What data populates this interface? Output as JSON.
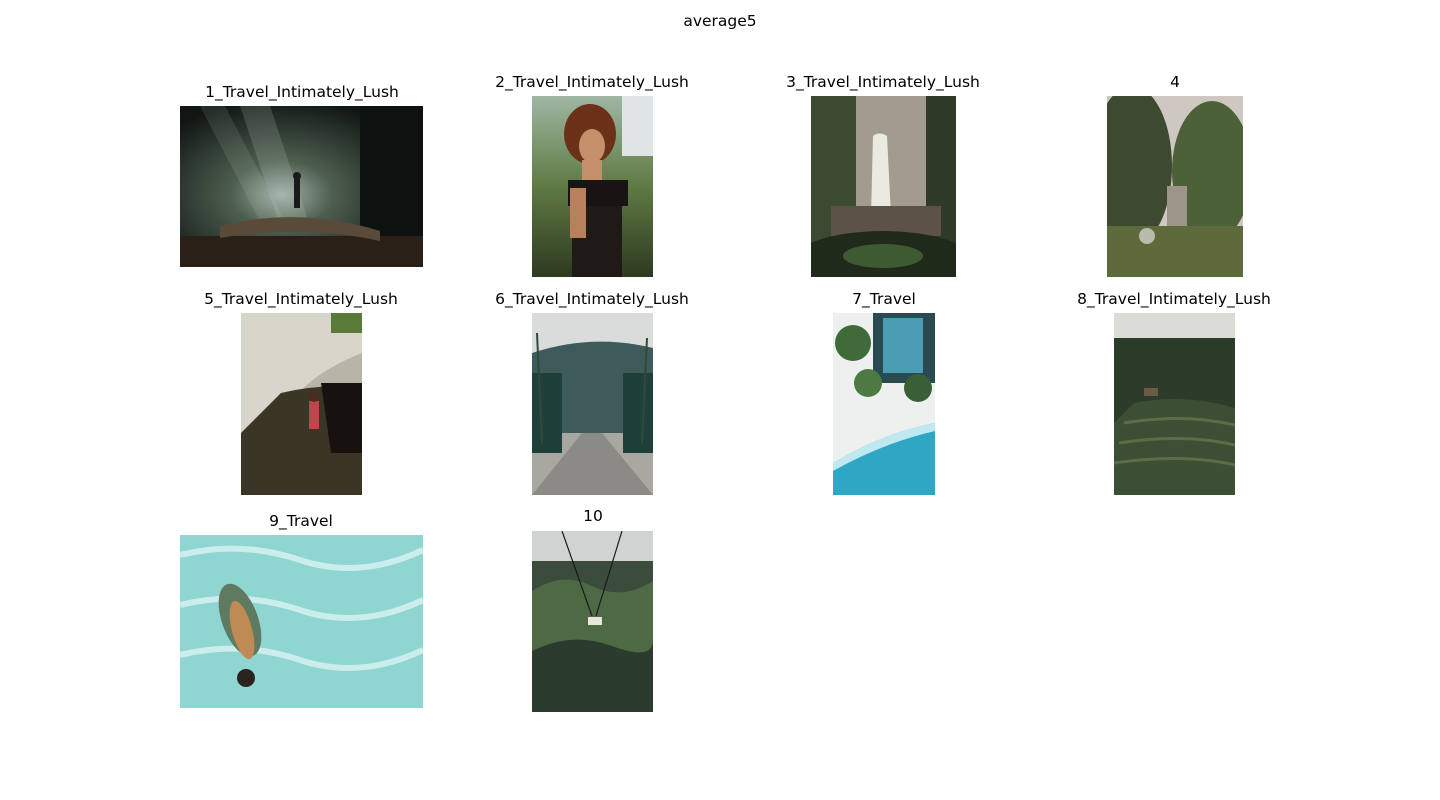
{
  "figure": {
    "title": "average5"
  },
  "images": [
    {
      "caption": "1_Travel_Intimately_Lush",
      "subject": "dark rainforest with hiker in light rays"
    },
    {
      "caption": "2_Travel_Intimately_Lush",
      "subject": "portrait of woman with curly hair among plants"
    },
    {
      "caption": "3_Travel_Intimately_Lush",
      "subject": "jungle waterfall with rocks and leaves"
    },
    {
      "caption": "4",
      "subject": "overgrown green trees and grass"
    },
    {
      "caption": "5_Travel_Intimately_Lush",
      "subject": "person climbing mossy rock face"
    },
    {
      "caption": "6_Travel_Intimately_Lush",
      "subject": "palm-lined road toward mountains"
    },
    {
      "caption": "7_Travel",
      "subject": "aerial beach with pool and palms"
    },
    {
      "caption": "8_Travel_Intimately_Lush",
      "subject": "terraced rice fields in jungle"
    },
    {
      "caption": "9_Travel",
      "subject": "swimmer underwater in turquoise pool"
    },
    {
      "caption": "10",
      "subject": "jungle swing over palm forest"
    }
  ]
}
